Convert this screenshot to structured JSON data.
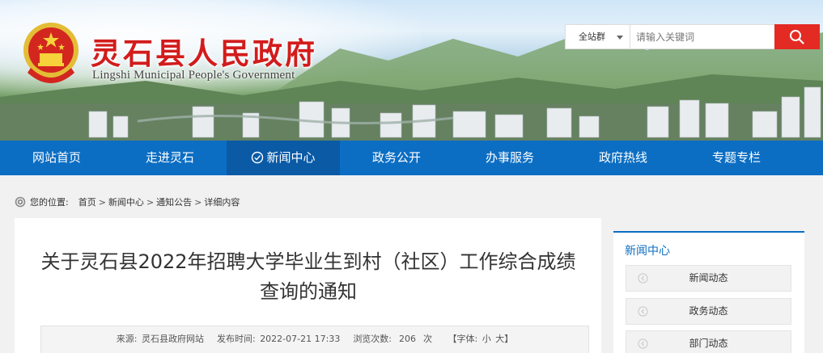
{
  "header": {
    "site_title": "灵石县人民政府",
    "site_subtitle": "Lingshi Municipal People's Government",
    "emblem_icon": "national-emblem-icon"
  },
  "search": {
    "scope_label": "全站群",
    "placeholder": "请输入关键词",
    "button_icon": "search-icon",
    "button_color": "#e32b24"
  },
  "nav": {
    "background_color": "#0c6ec3",
    "items": [
      {
        "label": "网站首页",
        "active": false
      },
      {
        "label": "走进灵石",
        "active": false
      },
      {
        "label": "新闻中心",
        "active": true
      },
      {
        "label": "政务公开",
        "active": false
      },
      {
        "label": "办事服务",
        "active": false
      },
      {
        "label": "政府热线",
        "active": false
      },
      {
        "label": "专题专栏",
        "active": false
      }
    ]
  },
  "breadcrumb": {
    "prefix": "您的位置:",
    "items": [
      "首页",
      "新闻中心",
      "通知公告",
      "详细内容"
    ],
    "separator": ">"
  },
  "article": {
    "title": "关于灵石县2022年招聘大学毕业生到村（社区）工作综合成绩查询的通知",
    "source_label": "来源:",
    "source_value": "灵石县政府网站",
    "publish_label": "发布时间:",
    "publish_value": "2022-07-21 17:33",
    "views_label": "浏览次数:",
    "views_value": "206",
    "views_unit": "次",
    "font_label": "【字体:",
    "font_small": "小",
    "font_large": "大】"
  },
  "sidebar": {
    "title": "新闻中心",
    "items": [
      "新闻动态",
      "政务动态",
      "部门动态"
    ]
  }
}
